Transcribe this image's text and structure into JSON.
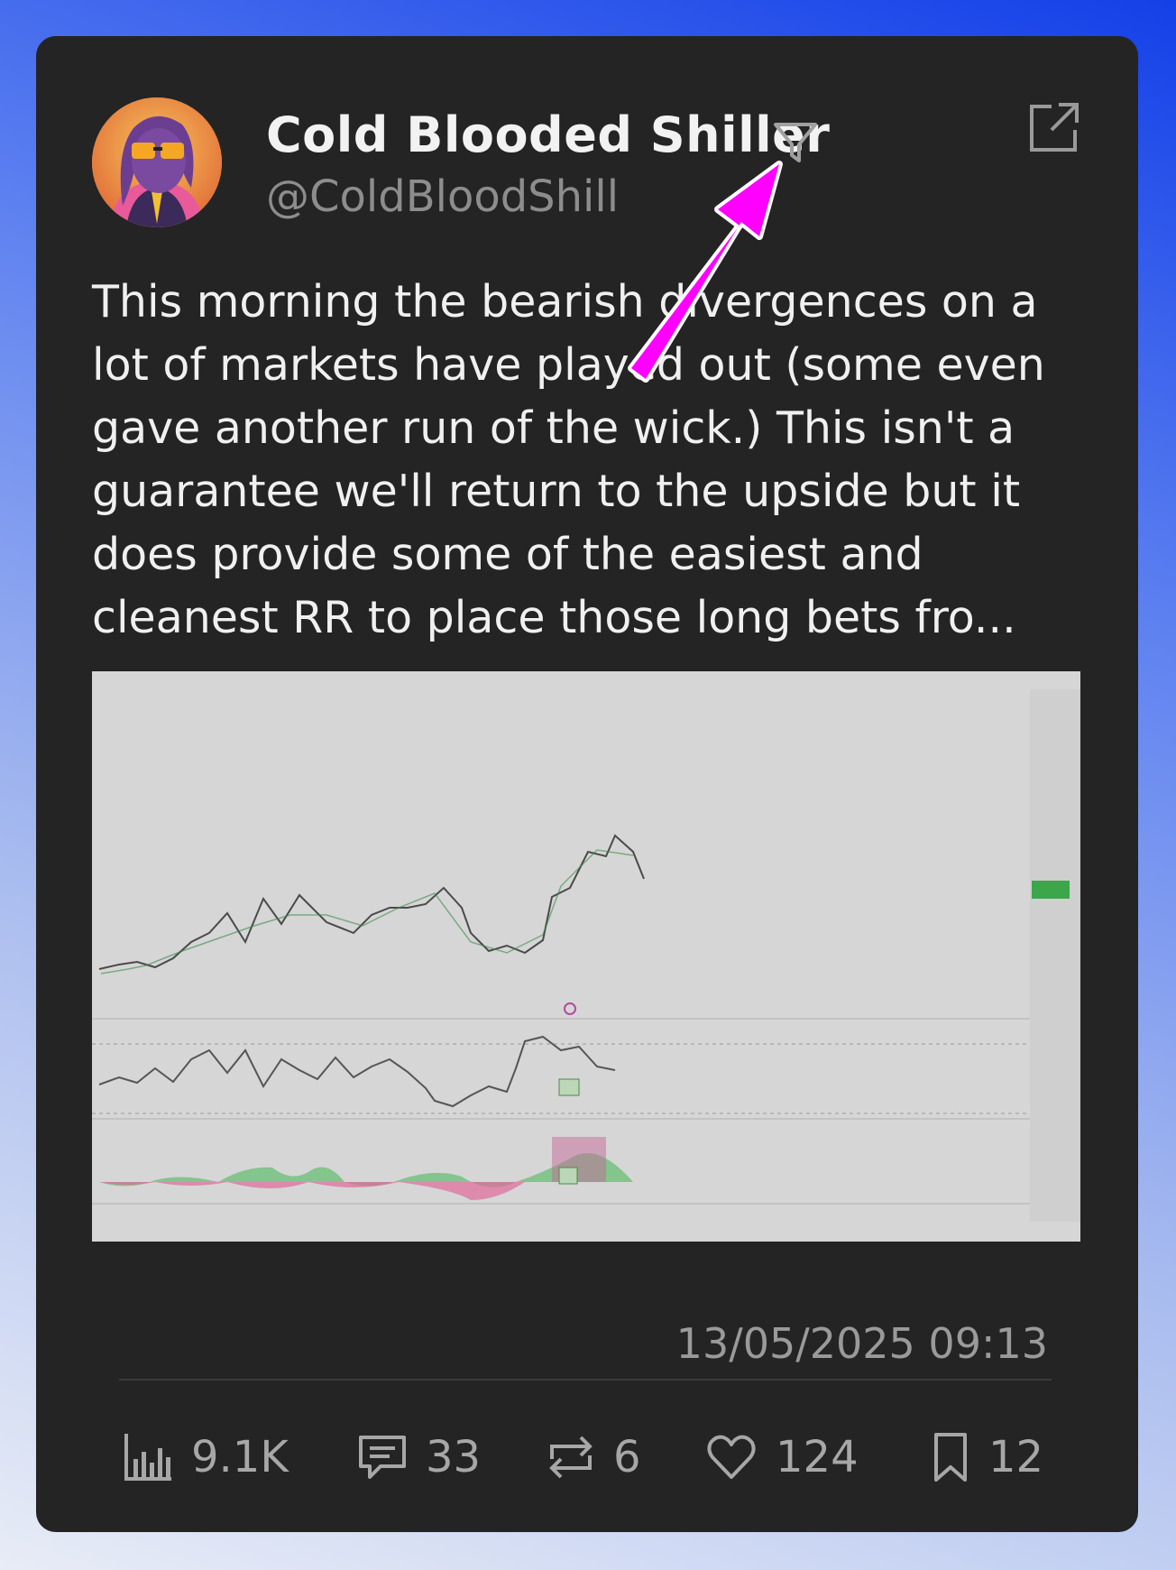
{
  "post": {
    "author_name": "Cold Blooded Shiller",
    "author_handle": "@ColdBloodShill",
    "text": "This morning the bearish divergences on a lot of markets have played out (some even gave another run of the wick.) This isn't a guarantee we'll return to the upside but it does provide some of the easiest and cleanest RR to place those long bets fro...",
    "timestamp": "13/05/2025 09:13"
  },
  "stats": {
    "views": "9.1K",
    "replies": "33",
    "reposts": "6",
    "likes": "124",
    "bookmarks": "12"
  },
  "icons": {
    "filter": "filter-icon",
    "share": "external-link-icon",
    "views": "bar-chart-icon",
    "replies": "comment-icon",
    "reposts": "repost-icon",
    "likes": "heart-icon",
    "bookmarks": "bookmark-icon"
  },
  "colors": {
    "card": "#242424",
    "annotation_arrow": "#ff00ff",
    "muted_text": "#9a9a9a"
  }
}
